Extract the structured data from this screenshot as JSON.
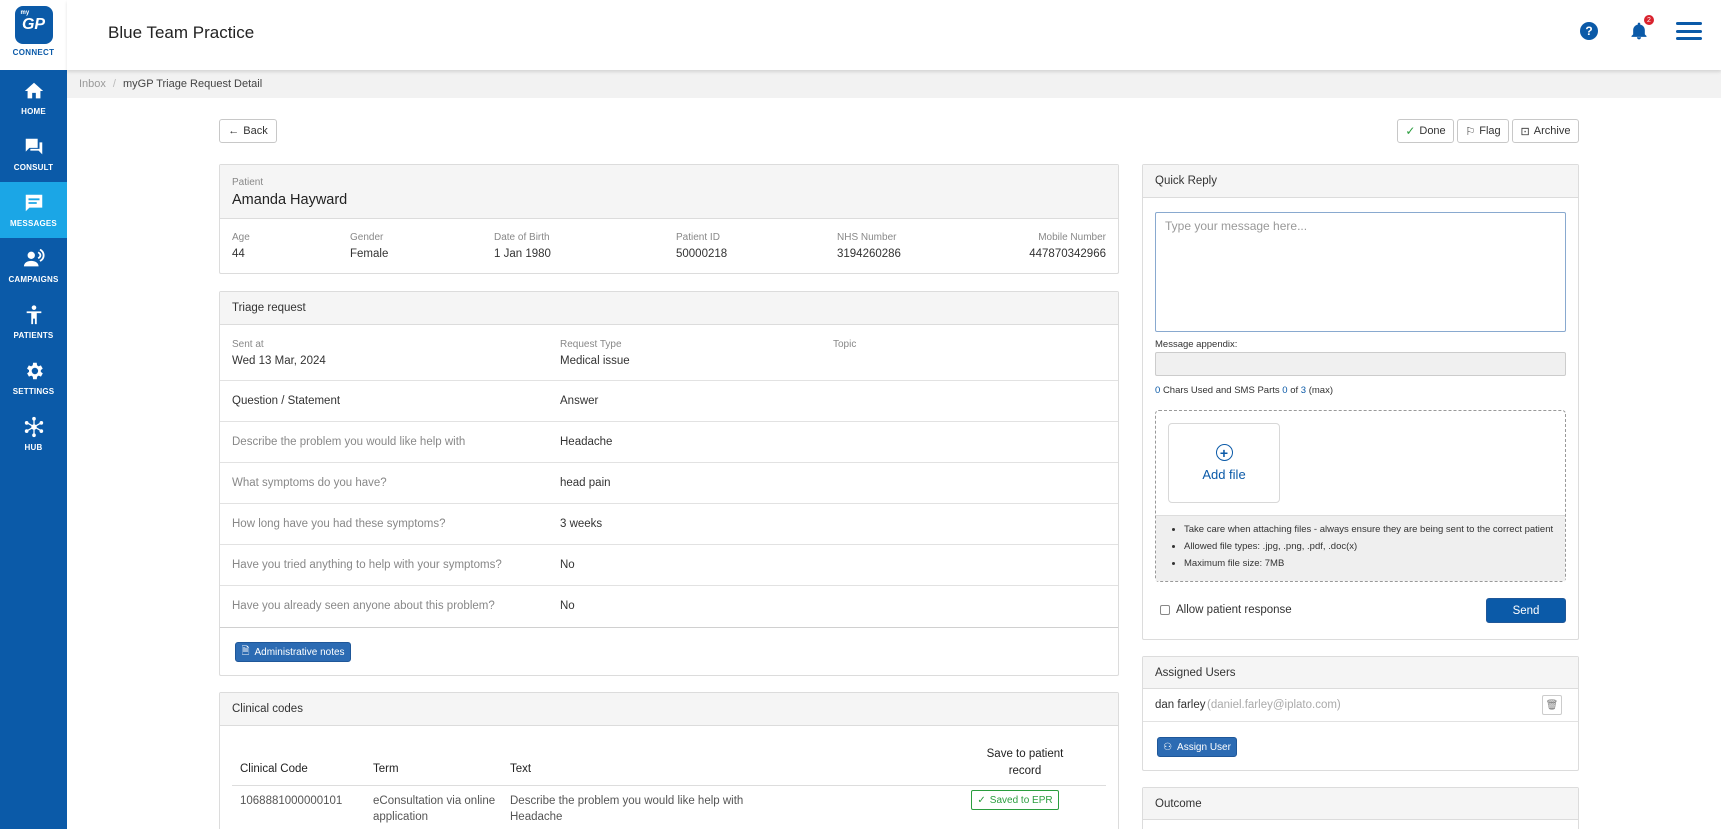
{
  "app": {
    "logo_small": "my",
    "logo_text": "GP",
    "logo_sub": "CONNECT",
    "practice_name": "Blue Team Practice",
    "notification_count": "2",
    "help_symbol": "?"
  },
  "sidebar": {
    "items": [
      {
        "label": "HOME",
        "icon": "home-icon"
      },
      {
        "label": "CONSULT",
        "icon": "chat-icon"
      },
      {
        "label": "MESSAGES",
        "icon": "message-icon",
        "active": true
      },
      {
        "label": "CAMPAIGNS",
        "icon": "campaign-icon"
      },
      {
        "label": "PATIENTS",
        "icon": "person-icon"
      },
      {
        "label": "SETTINGS",
        "icon": "gear-icon"
      },
      {
        "label": "HUB",
        "icon": "hub-icon"
      }
    ]
  },
  "breadcrumb": {
    "link": "Inbox",
    "separator": "/",
    "current": "myGP Triage Request Detail"
  },
  "actions": {
    "back": "Back",
    "done": "Done",
    "flag": "Flag",
    "archive": "Archive"
  },
  "patient": {
    "section_label": "Patient",
    "name": "Amanda Hayward",
    "fields": [
      {
        "label": "Age",
        "value": "44"
      },
      {
        "label": "Gender",
        "value": "Female"
      },
      {
        "label": "Date of Birth",
        "value": "1 Jan 1980"
      },
      {
        "label": "Patient ID",
        "value": "50000218"
      },
      {
        "label": "NHS Number",
        "value": "3194260286"
      },
      {
        "label": "Mobile Number",
        "value": "447870342966"
      }
    ]
  },
  "triage": {
    "title": "Triage request",
    "sent_at_label": "Sent at",
    "sent_at": "Wed 13 Mar, 2024",
    "request_type_label": "Request Type",
    "request_type": "Medical issue",
    "topic_label": "Topic",
    "question_header": "Question / Statement",
    "answer_header": "Answer",
    "rows": [
      {
        "q": "Describe the problem you would like help with",
        "a": "Headache"
      },
      {
        "q": "What symptoms do you have?",
        "a": "head pain"
      },
      {
        "q": "How long have you had these symptoms?",
        "a": "3 weeks"
      },
      {
        "q": "Have you tried anything to help with your symptoms?",
        "a": "No"
      },
      {
        "q": "Have you already seen anyone about this problem?",
        "a": "No"
      }
    ],
    "admin_notes": "Administrative notes"
  },
  "clinical_codes": {
    "title": "Clinical codes",
    "headers": {
      "code": "Clinical Code",
      "term": "Term",
      "text": "Text",
      "save": "Save to patient record"
    },
    "rows": [
      {
        "code": "1068881000000101",
        "term": "eConsultation via online application",
        "text": "Describe the problem you would like help with Headache",
        "status": "Saved to EPR"
      }
    ]
  },
  "quick_reply": {
    "title": "Quick Reply",
    "placeholder": "Type your message here...",
    "appendix_label": "Message appendix:",
    "chars_used": "0",
    "chars_text": "Chars Used and SMS Parts",
    "parts_used": "0",
    "of_text": "of",
    "parts_max": "3",
    "max_text": "(max)",
    "add_file": "Add file",
    "notes": [
      "Take care when attaching files - always ensure they are being sent to the correct patient",
      "Allowed file types: .jpg, .png, .pdf, .doc(x)",
      "Maximum file size: 7MB"
    ],
    "allow_response": "Allow patient response",
    "send": "Send"
  },
  "assigned_users": {
    "title": "Assigned Users",
    "user_name": "dan farley",
    "user_email": "(daniel.farley@iplato.com)",
    "assign_button": "Assign User"
  },
  "outcome": {
    "title": "Outcome"
  },
  "colors": {
    "brand": "#0b5aa8",
    "active_nav": "#1ba6e6",
    "success": "#2a9d3e",
    "primary_button": "#2c6bb3"
  }
}
